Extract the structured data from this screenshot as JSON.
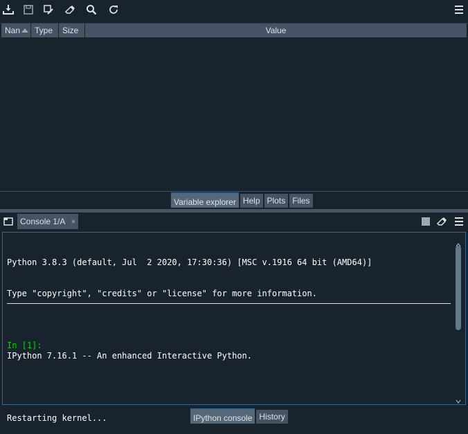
{
  "colors": {
    "background": "#19232d",
    "header": "#455364",
    "accent": "#346792",
    "prompt": "#00d600",
    "text": "#e0e1e3"
  },
  "variable_explorer": {
    "toolbar": {
      "icons": [
        "import-data-icon",
        "save-data-icon",
        "save-as-icon",
        "eraser-icon",
        "search-icon",
        "refresh-icon",
        "hamburger-menu-icon"
      ]
    },
    "columns": [
      {
        "label": "Nan",
        "sort": "ascending"
      },
      {
        "label": "Type"
      },
      {
        "label": "Size"
      },
      {
        "label": "Value"
      }
    ]
  },
  "top_tabs": [
    {
      "label": "Variable explorer",
      "active": true
    },
    {
      "label": "Help"
    },
    {
      "label": "Plots"
    },
    {
      "label": "Files"
    }
  ],
  "console": {
    "tab_label": "Console 1/A",
    "tab_close": "×",
    "lines": [
      "Python 3.8.3 (default, Jul  2 2020, 17:30:36) [MSC v.1916 64 bit (AMD64)]",
      "Type \"copyright\", \"credits\" or \"license\" for more information.",
      "",
      "IPython 7.16.1 -- An enhanced Interactive Python.",
      "",
      "Restarting kernel..."
    ],
    "prompt": "In [1]:"
  },
  "bottom_tabs": [
    {
      "label": "IPython console",
      "active": true
    },
    {
      "label": "History"
    }
  ]
}
